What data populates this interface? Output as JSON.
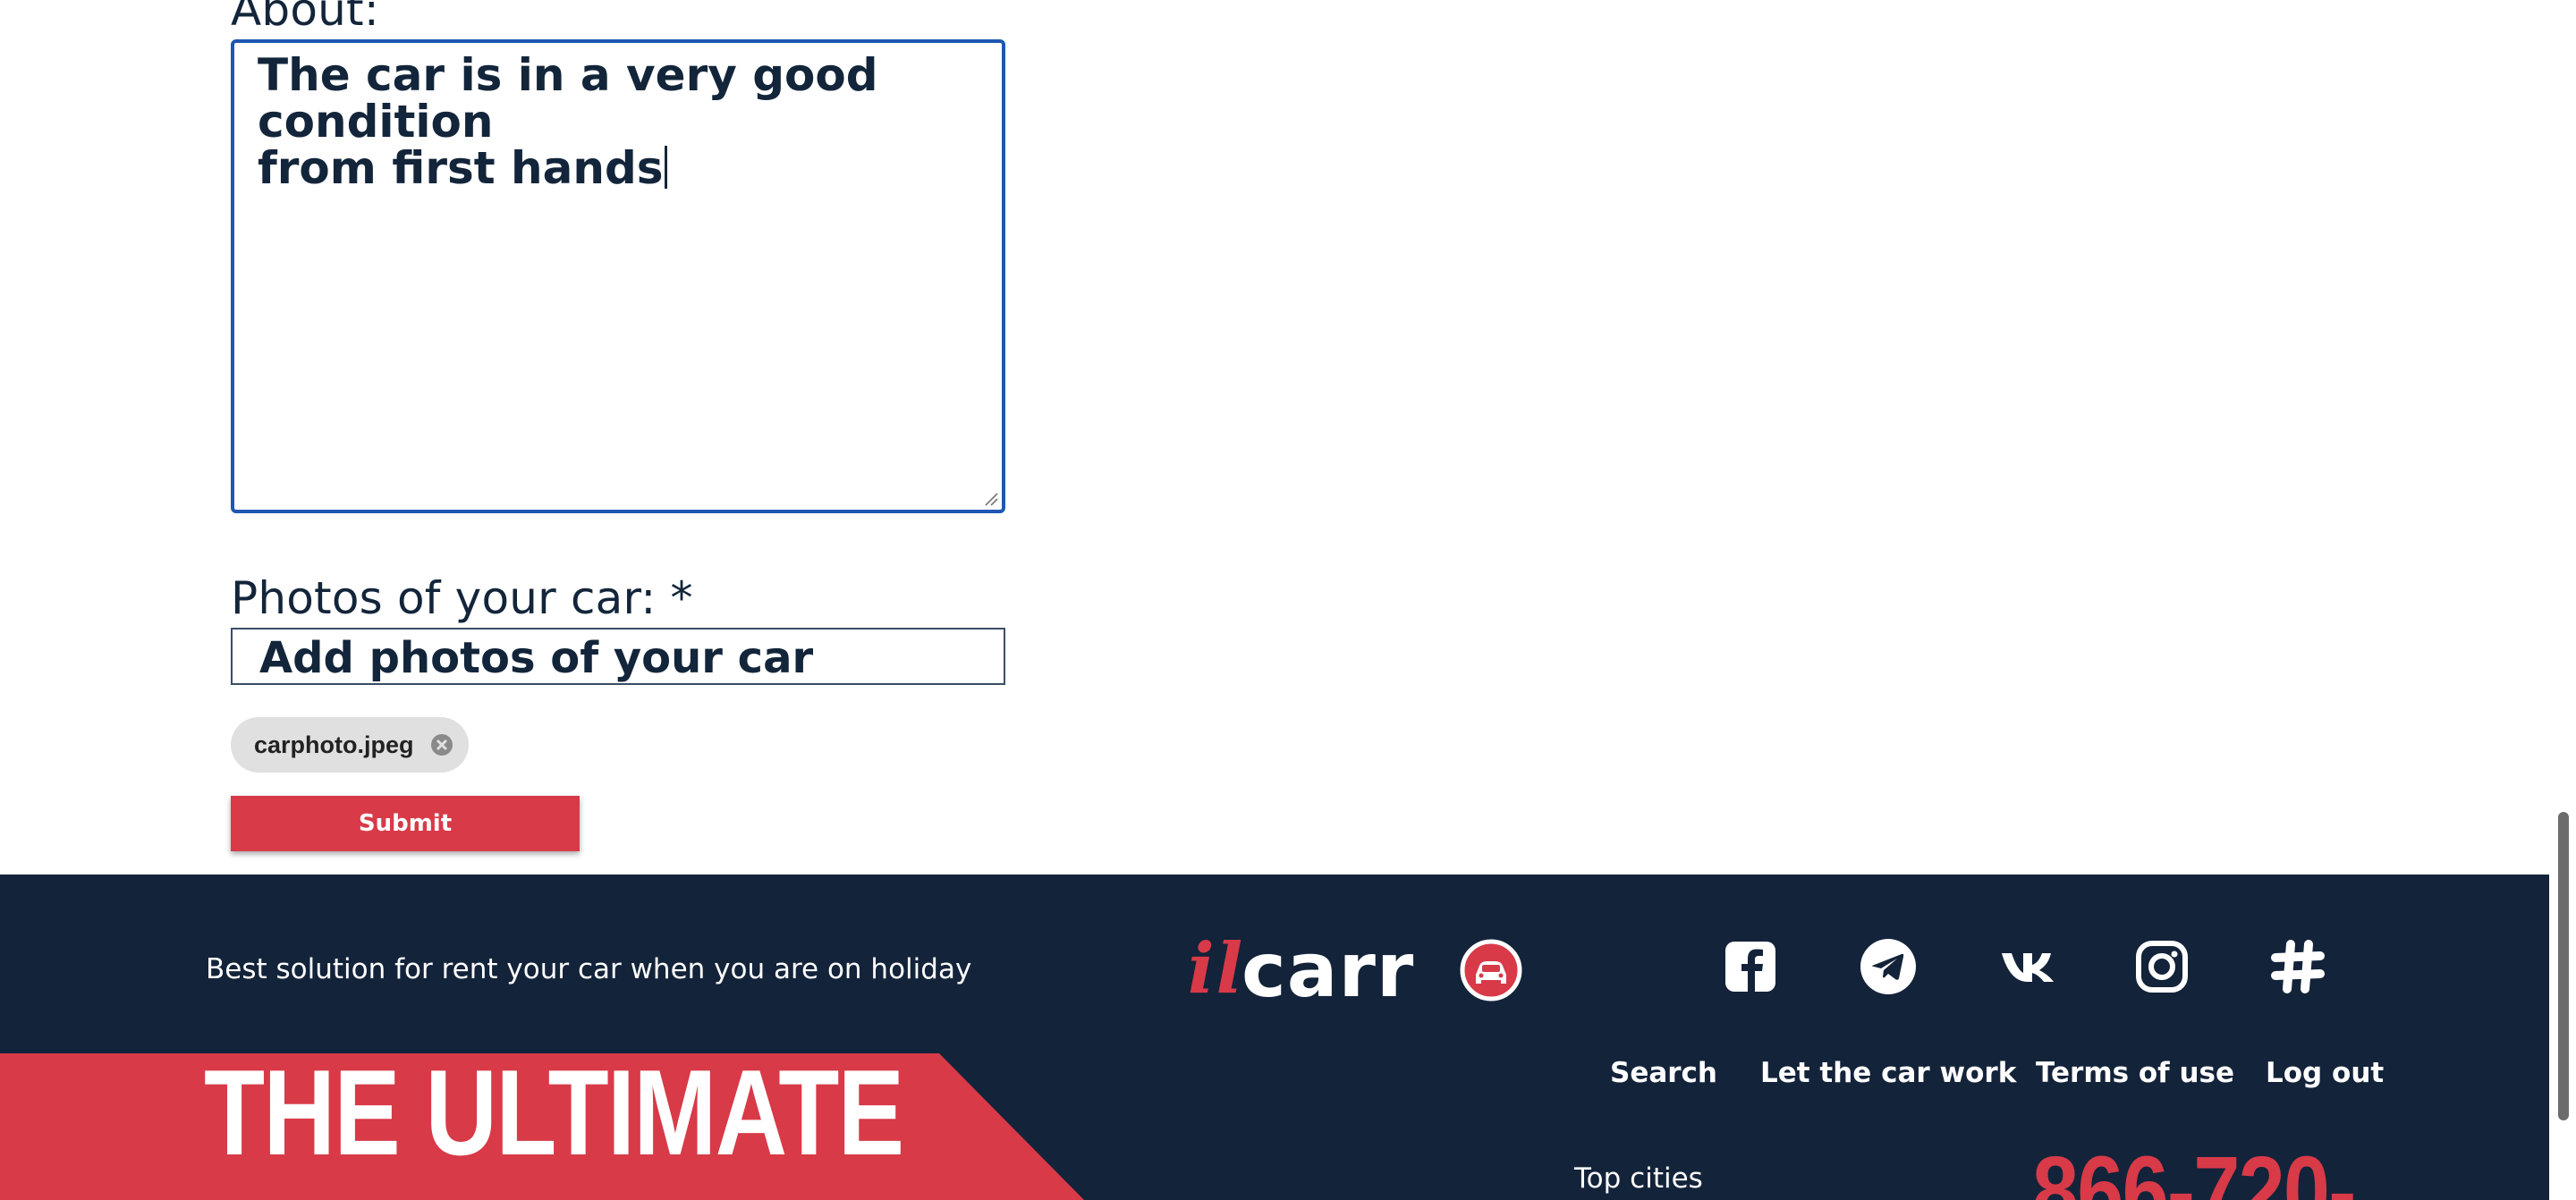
{
  "form": {
    "about_label": "About:",
    "about_value": "The car is in a very good condition\nfrom first hands",
    "photos_label": "Photos of your car: *",
    "photos_button": "Add photos of your car",
    "attached_file": "carphoto.jpeg",
    "submit_label": "Submit"
  },
  "footer": {
    "tagline": "Best solution for rent your car when you are on holiday",
    "logo": {
      "part1": "il",
      "part2": "carr"
    },
    "social_icons": [
      "facebook-icon",
      "telegram-icon",
      "vk-icon",
      "instagram-icon",
      "slack-icon"
    ],
    "nav": {
      "search": "Search",
      "let_car_work": "Let the car work",
      "terms": "Terms of use",
      "logout": "Log out"
    },
    "banner_text": "THE ULTIMATE",
    "top_cities": "Top cities",
    "phone_partial": "866-720-"
  },
  "colors": {
    "accent_red": "#d83a48",
    "footer_bg": "#13233a",
    "text_dark": "#13253a",
    "focus_border": "#1f57b2"
  }
}
